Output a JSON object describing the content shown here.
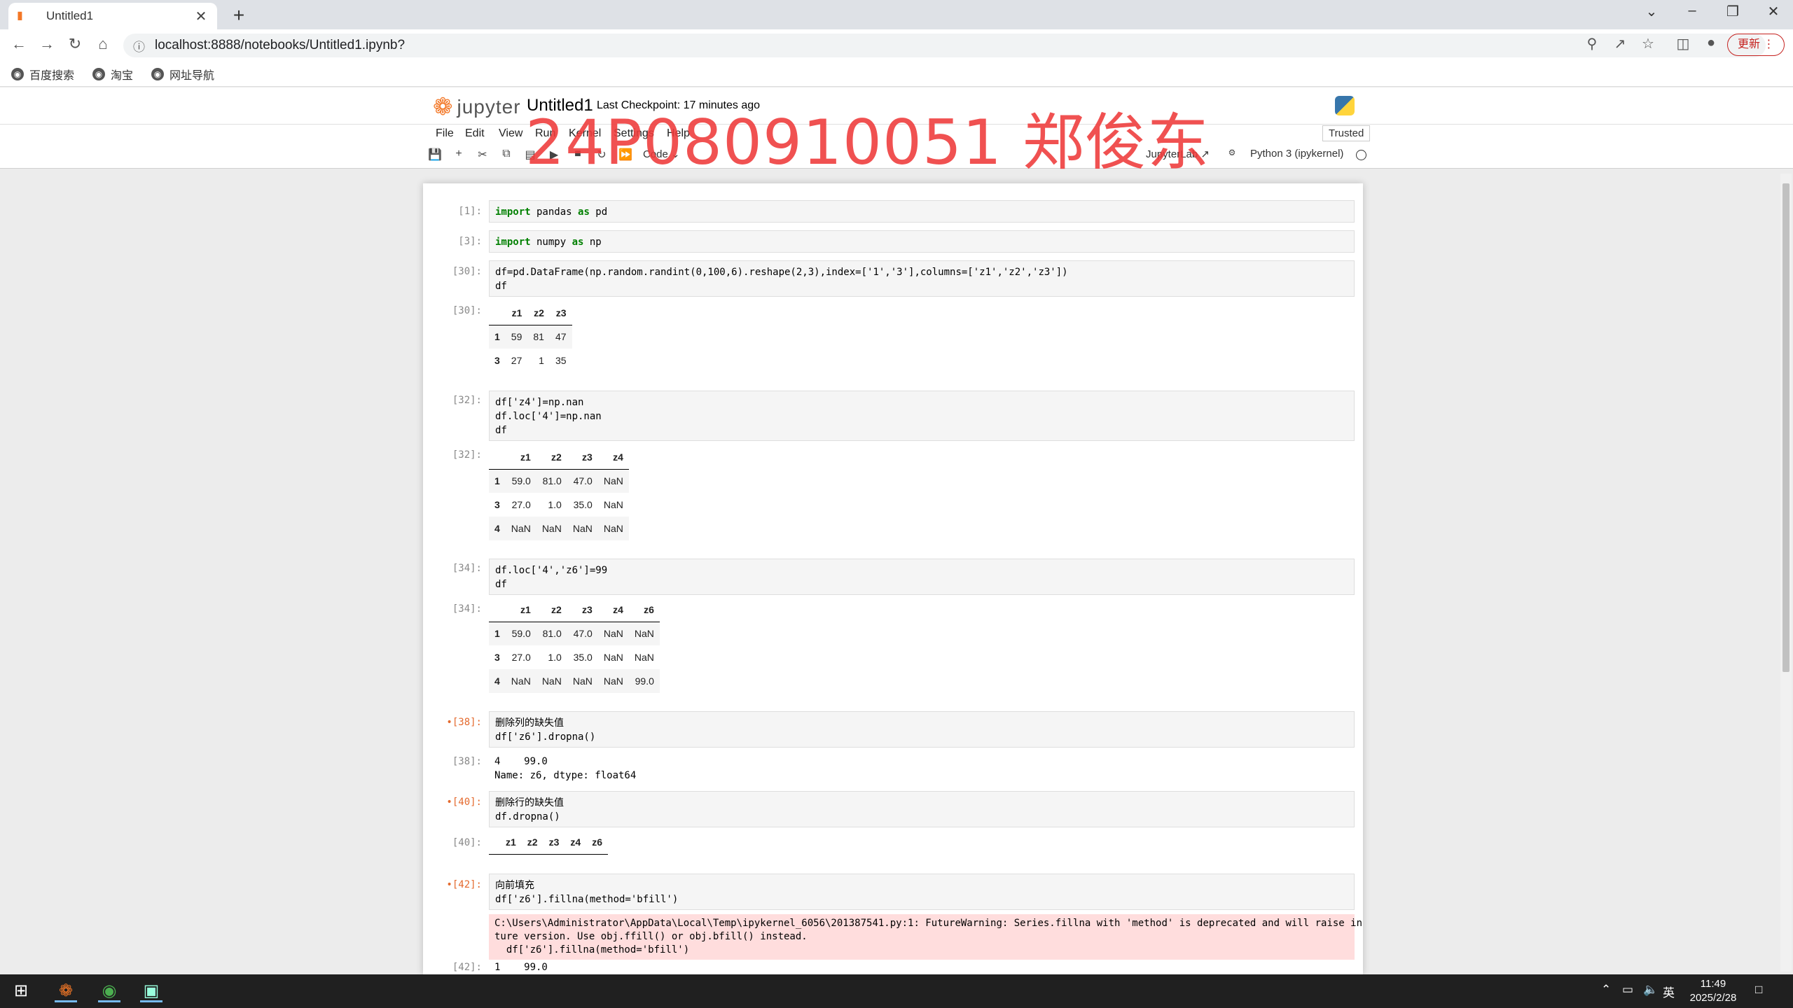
{
  "browser": {
    "tab_title": "Untitled1",
    "url": "localhost:8888/notebooks/Untitled1.ipynb?",
    "update_label": "更新",
    "bookmarks": [
      {
        "label": "百度搜索"
      },
      {
        "label": "淘宝"
      },
      {
        "label": "网址导航"
      }
    ]
  },
  "jupyter": {
    "logo_text": "jupyter",
    "notebook_name": "Untitled1",
    "checkpoint": "Last Checkpoint: 17 minutes ago",
    "menus": [
      "File",
      "Edit",
      "View",
      "Run",
      "Kernel",
      "Settings",
      "Help"
    ],
    "trusted": "Trusted",
    "cell_type": "Code",
    "jupyterlab_label": "JupyterLab",
    "kernel": "Python 3 (ipykernel)"
  },
  "watermark": "24P080910051  郑俊东",
  "cells": {
    "c1": {
      "prompt": "[1]:",
      "code": "import pandas as pd"
    },
    "c3": {
      "prompt": "[3]:",
      "code": "import numpy as np"
    },
    "c30": {
      "prompt": "[30]:",
      "code": "df=pd.DataFrame(np.random.randint(0,100,6).reshape(2,3),index=['1','3'],columns=['z1','z2','z3'])\ndf",
      "out_prompt": "[30]:",
      "table": {
        "columns": [
          "z1",
          "z2",
          "z3"
        ],
        "rows": [
          [
            "1",
            "59",
            "81",
            "47"
          ],
          [
            "3",
            "27",
            "1",
            "35"
          ]
        ]
      }
    },
    "c32": {
      "prompt": "[32]:",
      "code": "df['z4']=np.nan\ndf.loc['4']=np.nan\ndf",
      "out_prompt": "[32]:",
      "table": {
        "columns": [
          "z1",
          "z2",
          "z3",
          "z4"
        ],
        "rows": [
          [
            "1",
            "59.0",
            "81.0",
            "47.0",
            "NaN"
          ],
          [
            "3",
            "27.0",
            "1.0",
            "35.0",
            "NaN"
          ],
          [
            "4",
            "NaN",
            "NaN",
            "NaN",
            "NaN"
          ]
        ]
      }
    },
    "c34": {
      "prompt": "[34]:",
      "code": "df.loc['4','z6']=99\ndf",
      "out_prompt": "[34]:",
      "table": {
        "columns": [
          "z1",
          "z2",
          "z3",
          "z4",
          "z6"
        ],
        "rows": [
          [
            "1",
            "59.0",
            "81.0",
            "47.0",
            "NaN",
            "NaN"
          ],
          [
            "3",
            "27.0",
            "1.0",
            "35.0",
            "NaN",
            "NaN"
          ],
          [
            "4",
            "NaN",
            "NaN",
            "NaN",
            "NaN",
            "99.0"
          ]
        ]
      }
    },
    "c38": {
      "prompt": "[38]:",
      "comment": "删除列的缺失值",
      "code": "df['z6'].dropna()",
      "out_prompt": "[38]:",
      "output": "4    99.0\nName: z6, dtype: float64"
    },
    "c40": {
      "prompt": "[40]:",
      "comment": "删除行的缺失值",
      "code": "df.dropna()",
      "out_prompt": "[40]:",
      "table": {
        "columns": [
          "z1",
          "z2",
          "z3",
          "z4",
          "z6"
        ],
        "rows": []
      }
    },
    "c42": {
      "prompt": "[42]:",
      "comment": "向前填充",
      "code": "df['z6'].fillna(method='bfill')",
      "warning": "C:\\Users\\Administrator\\AppData\\Local\\Temp\\ipykernel_6056\\201387541.py:1: FutureWarning: Series.fillna with 'method' is deprecated and will raise in a fu\nture version. Use obj.ffill() or obj.bfill() instead.\n  df['z6'].fillna(method='bfill')",
      "out_prompt": "[42]:",
      "output": "1    99.0"
    }
  },
  "taskbar": {
    "time": "11:49",
    "date": "2025/2/28",
    "ime": "英"
  }
}
